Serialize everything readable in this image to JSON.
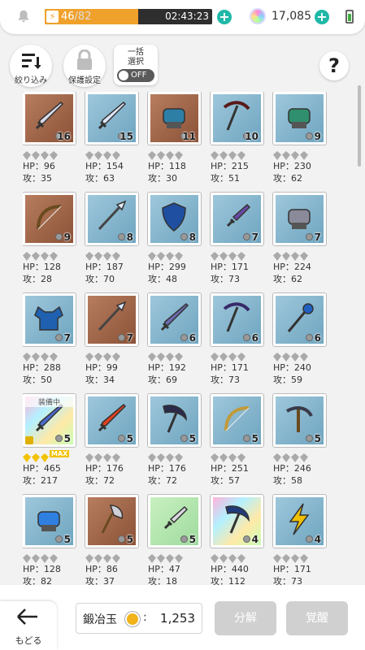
{
  "header": {
    "stamina_current": "46",
    "stamina_max": "/82",
    "stamina_fill": 0.56,
    "stamina_timer": "02:43:23",
    "gem_count": "17,085"
  },
  "toolbar": {
    "filter_label": "絞り込み",
    "protect_label": "保護設定",
    "bulk_label_1": "一括",
    "bulk_label_2": "選択",
    "toggle_label": "OFF",
    "help_label": "?"
  },
  "items": [
    {
      "hp": "HP：96",
      "atk": "攻：35",
      "count": "16",
      "bg": "bg-brown",
      "color": "#d9d9e6",
      "icon": "sword-icon"
    },
    {
      "hp": "HP：154",
      "atk": "攻：63",
      "count": "15",
      "bg": "bg-blue",
      "color": "#dfe8ff",
      "icon": "sword-icon"
    },
    {
      "hp": "HP：118",
      "atk": "攻：30",
      "count": "11",
      "bg": "bg-brown",
      "color": "#2d7fa6",
      "icon": "gauntlet-icon"
    },
    {
      "hp": "HP：215",
      "atk": "攻：51",
      "count": "10",
      "bg": "bg-blue",
      "color": "#5a1a1a",
      "icon": "pickaxe-icon"
    },
    {
      "hp": "HP：230",
      "atk": "攻：62",
      "count": "9",
      "bg": "bg-blue",
      "color": "#2f8f6e",
      "icon": "gauntlet-icon"
    },
    {
      "hp": "HP：128",
      "atk": "攻：28",
      "count": "9",
      "bg": "bg-brown",
      "color": "#6b4a1f",
      "icon": "bow-icon"
    },
    {
      "hp": "HP：187",
      "atk": "攻：70",
      "count": "8",
      "bg": "bg-blue",
      "color": "#e8eef5",
      "icon": "spear-icon"
    },
    {
      "hp": "HP：299",
      "atk": "攻：48",
      "count": "8",
      "bg": "bg-blue",
      "color": "#1f4fa0",
      "icon": "shield-icon"
    },
    {
      "hp": "HP：171",
      "atk": "攻：73",
      "count": "7",
      "bg": "bg-blue",
      "color": "#6a4aa8",
      "icon": "dagger-icon"
    },
    {
      "hp": "HP：224",
      "atk": "攻：62",
      "count": "7",
      "bg": "bg-blue",
      "color": "#8a8a9a",
      "icon": "gauntlet-icon"
    },
    {
      "hp": "HP：288",
      "atk": "攻：50",
      "count": "7",
      "bg": "bg-blue",
      "color": "#2060b0",
      "icon": "armor-icon"
    },
    {
      "hp": "HP：99",
      "atk": "攻：34",
      "count": "7",
      "bg": "bg-brown",
      "color": "#dfe8ff",
      "icon": "spear-icon"
    },
    {
      "hp": "HP：192",
      "atk": "攻：69",
      "count": "6",
      "bg": "bg-blue",
      "color": "#6a6ab0",
      "icon": "sword-icon"
    },
    {
      "hp": "HP：171",
      "atk": "攻：73",
      "count": "6",
      "bg": "bg-blue",
      "color": "#3a2a6a",
      "icon": "pickaxe-icon"
    },
    {
      "hp": "HP：240",
      "atk": "攻：59",
      "count": "6",
      "bg": "bg-blue",
      "color": "#1f5fc0",
      "icon": "staff-icon"
    },
    {
      "hp": "HP：465",
      "atk": "攻：217",
      "count": "5",
      "bg": "bg-rainbow",
      "color": "#4a6ad0",
      "icon": "sword-icon",
      "equipped": "装備中",
      "locked": true,
      "max": true
    },
    {
      "hp": "HP：176",
      "atk": "攻：72",
      "count": "5",
      "bg": "bg-blue",
      "color": "#e0401f",
      "icon": "sword-icon"
    },
    {
      "hp": "HP：176",
      "atk": "攻：72",
      "count": "5",
      "bg": "bg-blue",
      "color": "#2a2a4a",
      "icon": "scythe-icon"
    },
    {
      "hp": "HP：251",
      "atk": "攻：57",
      "count": "5",
      "bg": "bg-blue",
      "color": "#c09a3a",
      "icon": "bow-icon"
    },
    {
      "hp": "HP：246",
      "atk": "攻：58",
      "count": "5",
      "bg": "bg-blue",
      "color": "#3a3a4a",
      "icon": "crossbow-icon"
    },
    {
      "hp": "HP：128",
      "atk": "攻：82",
      "count": "5",
      "bg": "bg-blue",
      "color": "#2f7fe0",
      "icon": "gauntlet-icon"
    },
    {
      "hp": "HP：86",
      "atk": "攻：37",
      "count": "5",
      "bg": "bg-brown",
      "color": "#d0d0d8",
      "icon": "axe-icon"
    },
    {
      "hp": "HP：47",
      "atk": "攻：18",
      "count": "5",
      "bg": "bg-green",
      "color": "#d8d8e0",
      "icon": "dagger-icon"
    },
    {
      "hp": "HP：440",
      "atk": "攻：112",
      "count": "4",
      "bg": "bg-rainbow",
      "color": "#203a7a",
      "icon": "scythe-icon"
    },
    {
      "hp": "HP：171",
      "atk": "攻：73",
      "count": "4",
      "bg": "bg-blue",
      "color": "#f0c000",
      "icon": "lightning-icon"
    }
  ],
  "footer": {
    "back_label": "もどる",
    "orb_label": "鍛冶玉",
    "orb_colon": ":",
    "orb_value": "1,253",
    "disassemble_label": "分解",
    "awaken_label": "覚醒"
  }
}
